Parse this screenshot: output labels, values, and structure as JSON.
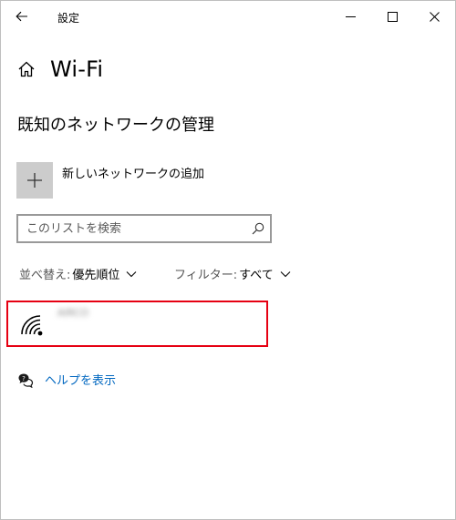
{
  "window": {
    "title": "設定",
    "controls": {
      "back": "back-arrow",
      "minimize": "minimize",
      "maximize": "maximize",
      "close": "close"
    }
  },
  "page": {
    "title": "Wi-Fi",
    "icon": "home-icon"
  },
  "section": {
    "title": "既知のネットワークの管理"
  },
  "add_network": {
    "label": "新しいネットワークの追加",
    "icon": "plus-icon"
  },
  "search": {
    "placeholder": "このリストを検索",
    "value": ""
  },
  "sort": {
    "label": "並べ替え:",
    "value": "優先順位"
  },
  "filter": {
    "label": "フィルター:",
    "value": "すべて"
  },
  "networks": [
    {
      "name": "AIRCO",
      "icon": "wifi-icon",
      "selected": true,
      "name_obscured": true
    }
  ],
  "help": {
    "label": "ヘルプを表示",
    "icon": "help-chat-icon"
  },
  "colors": {
    "accent_link": "#0067c0",
    "highlight_border": "#e60012",
    "add_tile": "#cccccc"
  }
}
